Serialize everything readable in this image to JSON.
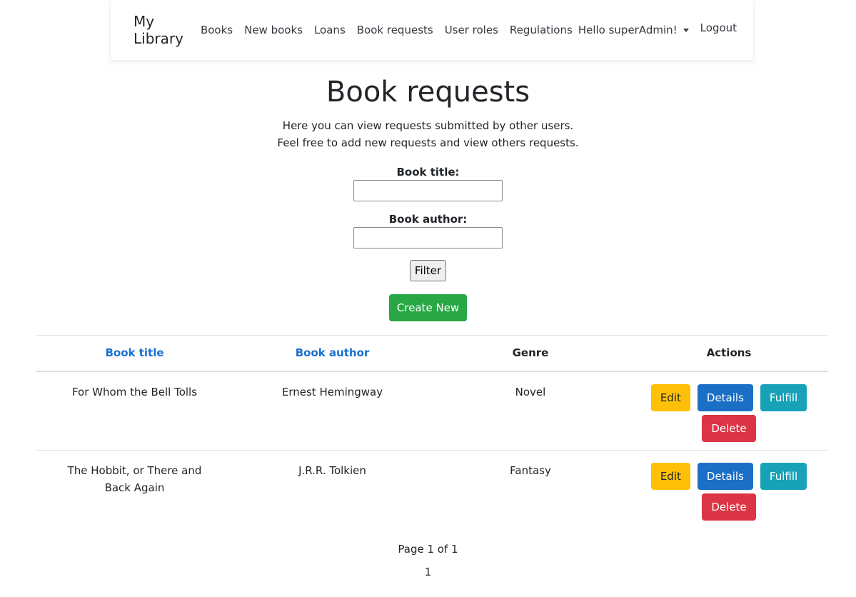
{
  "nav": {
    "brand": "My Library",
    "links": [
      "Books",
      "New books",
      "Loans",
      "Book requests",
      "User roles",
      "Regulations"
    ],
    "user_greeting": "Hello superAdmin!",
    "logout": "Logout"
  },
  "page": {
    "title": "Book requests",
    "intro_line1": "Here you can view requests submitted by other users.",
    "intro_line2": "Feel free to add new requests and view others requests."
  },
  "filter": {
    "title_label": "Book title:",
    "title_value": "",
    "author_label": "Book author:",
    "author_value": "",
    "filter_button": "Filter",
    "create_button": "Create New"
  },
  "table": {
    "headers": {
      "title": "Book title",
      "author": "Book author",
      "genre": "Genre",
      "actions": "Actions"
    },
    "rows": [
      {
        "title": "For Whom the Bell Tolls",
        "author": "Ernest Hemingway",
        "genre": "Novel"
      },
      {
        "title": "The Hobbit, or There and Back Again",
        "author": "J.R.R. Tolkien",
        "genre": "Fantasy"
      }
    ],
    "action_labels": {
      "edit": "Edit",
      "details": "Details",
      "fulfill": "Fulfill",
      "delete": "Delete"
    }
  },
  "pagination": {
    "info": "Page 1 of 1",
    "current": "1"
  },
  "colors": {
    "link": "#1a6fd1",
    "create": "#28a745",
    "edit": "#ffc107",
    "details": "#1c6fc6",
    "fulfill": "#17a2b8",
    "delete": "#dc3545"
  }
}
